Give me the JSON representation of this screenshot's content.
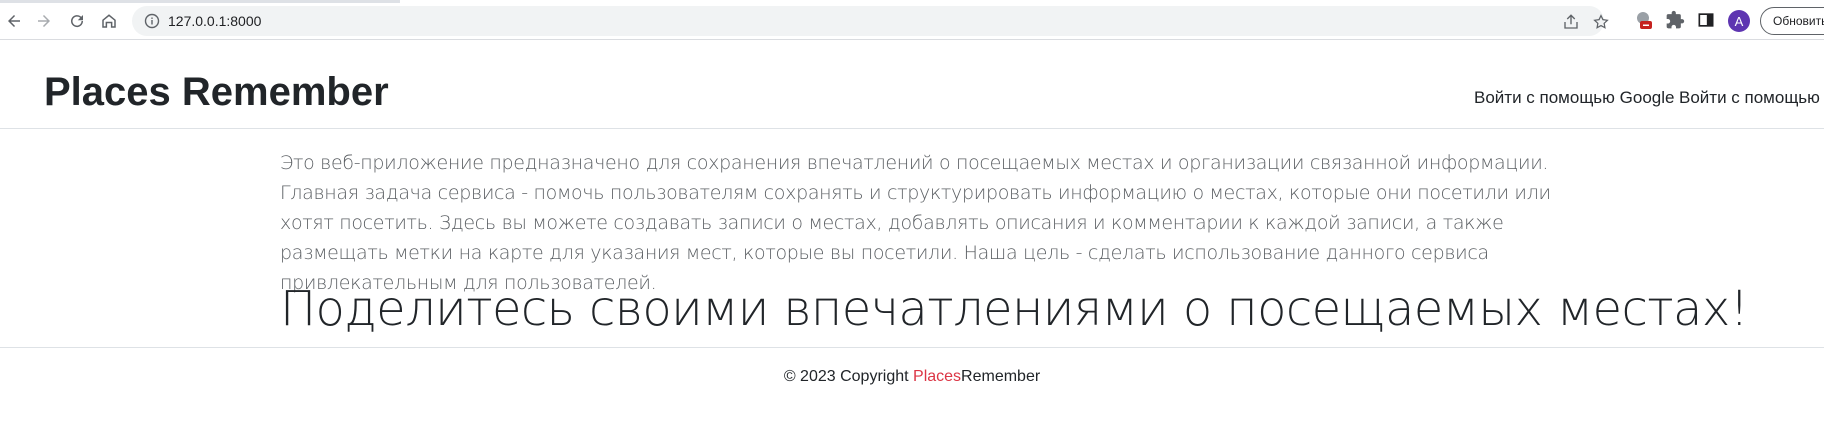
{
  "browser": {
    "url": "127.0.0.1:8000",
    "update_button": "Обновить",
    "avatar_letter": "A",
    "icons": [
      "back-icon",
      "forward-icon",
      "reload-icon",
      "home-icon",
      "site-info-icon",
      "share-icon",
      "bookmark-star-icon",
      "extension-badge-icon",
      "puzzle-icon",
      "side-panel-icon"
    ]
  },
  "header": {
    "brand": "Places Remember",
    "nav": [
      {
        "label": "Войти с помощью Google"
      },
      {
        "label": "Войти с помощью V"
      }
    ]
  },
  "main": {
    "lead": "Это веб-приложение предназначено для сохранения впечатлений о посещаемых местах и организации связанной информации. Главная задача сервиса - помочь пользователям сохранять и структурировать информацию о местах, которые они посетили или хотят посетить. Здесь вы можете создавать записи о местах, добавлять описания и комментарии к каждой записи, а также размещать метки на карте для указания мест, которые вы посетили. Наша цель - сделать использование данного сервиса привлекательным для пользователей.",
    "headline": "Поделитесь своими впечатлениями о посещаемых местах!"
  },
  "footer": {
    "copyright": "© 2023 Copyright ",
    "brand_accent": "Places",
    "brand_rest": "Remember"
  },
  "colors": {
    "accent": "#dc3545",
    "text": "#212529",
    "muted": "#5b5f63"
  }
}
